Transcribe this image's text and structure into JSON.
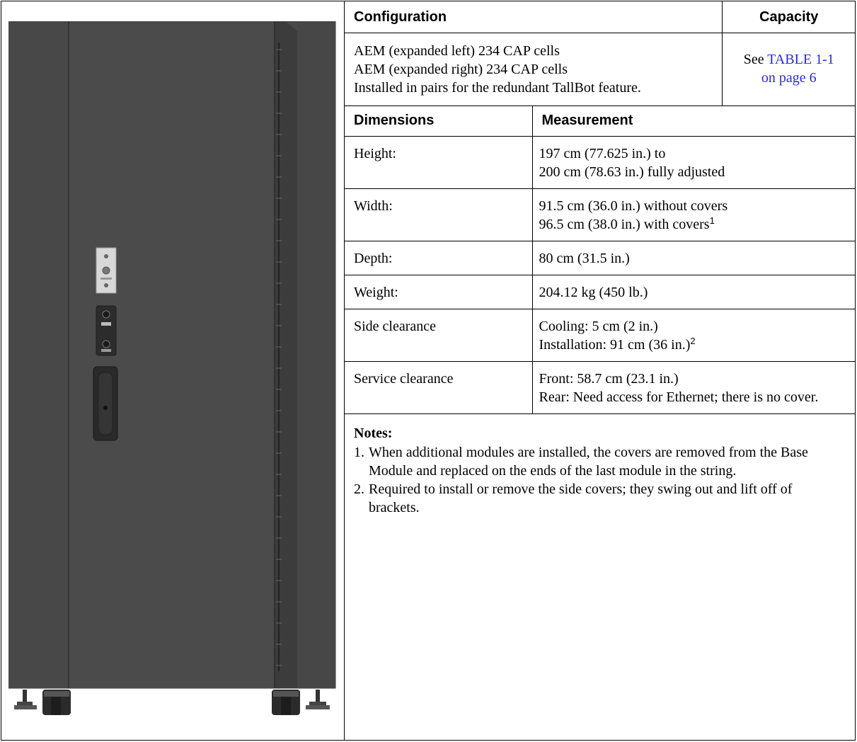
{
  "config_table": {
    "header_config": "Configuration",
    "header_capacity": "Capacity",
    "lines": [
      "AEM (expanded left) 234 CAP cells",
      "AEM (expanded right) 234 CAP cells",
      "Installed in pairs for the redundant TallBot feature."
    ],
    "capacity_prefix": "See ",
    "capacity_link": "TABLE 1-1",
    "capacity_link2": "on page 6"
  },
  "dims_table": {
    "header_dimensions": "Dimensions",
    "header_measurement": "Measurement",
    "rows": [
      {
        "label": "Height:",
        "line1": "197 cm (77.625 in.) to",
        "line2": "200 cm (78.63 in.) fully adjusted"
      },
      {
        "label": "Width:",
        "line1": "91.5 cm (36.0 in.) without covers",
        "line2": "96.5 cm (38.0 in.) with covers",
        "sup2": "1"
      },
      {
        "label": "Depth:",
        "line1": "80 cm (31.5 in.)"
      },
      {
        "label": "Weight:",
        "line1": "204.12 kg (450 lb.)"
      },
      {
        "label": "Side clearance",
        "line1": "Cooling: 5 cm (2 in.)",
        "line2": "Installation: 91 cm (36 in.)",
        "sup2": "2"
      },
      {
        "label": "Service clearance",
        "line1": "Front: 58.7 cm (23.1 in.)",
        "line2": "Rear: Need access for Ethernet; there is no cover."
      }
    ]
  },
  "notes": {
    "title": "Notes:",
    "items": [
      {
        "num": "1.",
        "text": "When additional modules are installed, the covers are removed from the Base Module and replaced on the ends of the last module in the string."
      },
      {
        "num": "2.",
        "text": "Required to install or remove the side covers; they swing out and lift off of brackets."
      }
    ]
  },
  "colors": {
    "cabinet": "#4a4a4a",
    "cabinet_edge": "#3a3a3a",
    "link": "#2a2ad6"
  }
}
